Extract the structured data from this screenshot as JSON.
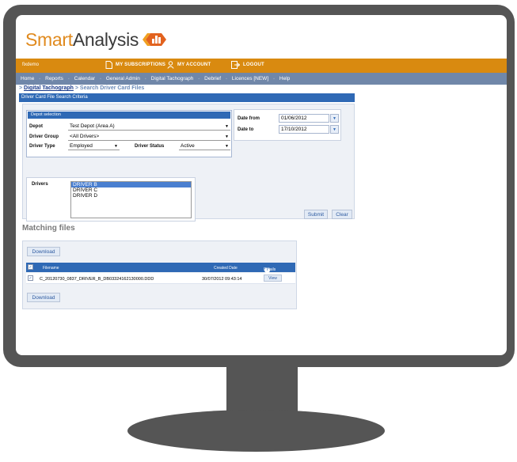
{
  "logo": {
    "smart": "Smart",
    "analysis": "Analysis"
  },
  "topbar": {
    "user": "fixdemo",
    "subscriptions": "MY SUBSCRIPTIONS",
    "account": "MY ACCOUNT",
    "logout": "LOGOUT"
  },
  "nav": {
    "items": [
      "Home",
      "Reports",
      "Calendar",
      "General Admin",
      "Digital Tachograph",
      "Debrief",
      "Licences [NEW]",
      "Help"
    ]
  },
  "breadcrumb": {
    "prefix": ">",
    "link": "Digital Tachograph",
    "current": "> Search Driver Card Files"
  },
  "criteria": {
    "title": "Driver Card File Search Criteria",
    "depot_selection": "Depot selection",
    "depot_label": "Depot",
    "depot_value": "Test Depot (Area A)",
    "group_label": "Driver Group",
    "group_value": "<All Drivers>",
    "type_label": "Driver Type",
    "type_value": "Employed",
    "status_label": "Driver Status",
    "status_value": "Active",
    "date_from_label": "Date from",
    "date_from_value": "01/06/2012",
    "date_to_label": "Date to",
    "date_to_value": "17/10/2012",
    "drivers_label": "Drivers",
    "drivers": [
      "DRIVER B",
      "DRIVER C",
      "DRIVER D"
    ],
    "submit": "Submit",
    "clear": "Clear"
  },
  "matching": {
    "title": "Matching files",
    "download": "Download",
    "columns": {
      "filename": "Filename",
      "created": "Created Date",
      "details": "Details"
    },
    "rows": [
      {
        "filename": "C_20120730_0837_DRIVER_B_DB03324162130000.DDD",
        "created": "30/07/2012 09:43:14",
        "action": "View"
      }
    ]
  },
  "colors": {
    "orange": "#d98a10",
    "nav": "#7087a9",
    "blue": "#2f69b5",
    "bezel": "#555555"
  }
}
